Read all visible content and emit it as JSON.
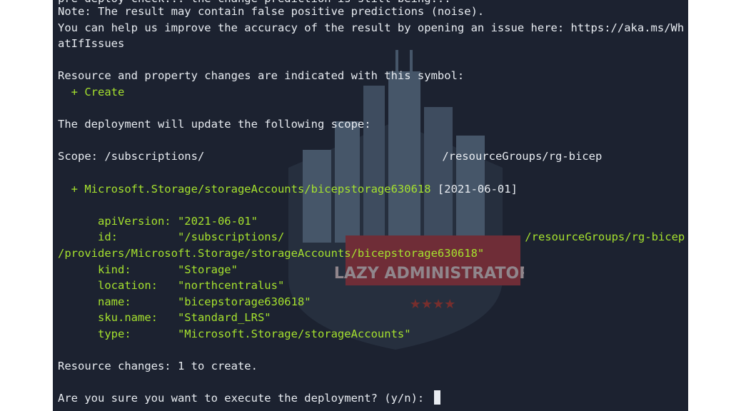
{
  "terminal": {
    "lines": {
      "top_cut": "pre-deploy check... the change prediction is still being...",
      "note": "Note: The result may contain false positive predictions (noise).",
      "help1": "You can help us improve the accuracy of the result by opening an issue here: https://aka.ms/Wh",
      "help2": "atIfIssues",
      "symbols": "Resource and property changes are indicated with this symbol:",
      "create_symbol": "  + Create",
      "update_scope": "The deployment will update the following scope:",
      "scope_prefix": "Scope: /subscriptions/",
      "scope_suffix": "/resourceGroups/rg-bicep",
      "resource_plus": "  + ",
      "resource_name": "Microsoft.Storage/storageAccounts/bicepstorage630618",
      "resource_version": " [2021-06-01]",
      "apiversion": "      apiVersion: \"2021-06-01\"",
      "id_prefix": "      id:         \"/subscriptions/",
      "id_suffix": "/resourceGroups/rg-bicep",
      "id_line2": "/providers/Microsoft.Storage/storageAccounts/bicepstorage630618\"",
      "kind": "      kind:       \"Storage\"",
      "location": "      location:   \"northcentralus\"",
      "name": "      name:       \"bicepstorage630618\"",
      "sku": "      sku.name:   \"Standard_LRS\"",
      "type": "      type:       \"Microsoft.Storage/storageAccounts\"",
      "summary": "Resource changes: 1 to create.",
      "prompt": "Are you sure you want to execute the deployment? (y/n): "
    }
  },
  "watermark": {
    "text": "LAZY ADMINISTRATOR",
    "stars": "★★★★"
  },
  "colors": {
    "terminal_bg": "#1c2230",
    "green": "#a6e22e",
    "text": "#e8ecf1"
  }
}
